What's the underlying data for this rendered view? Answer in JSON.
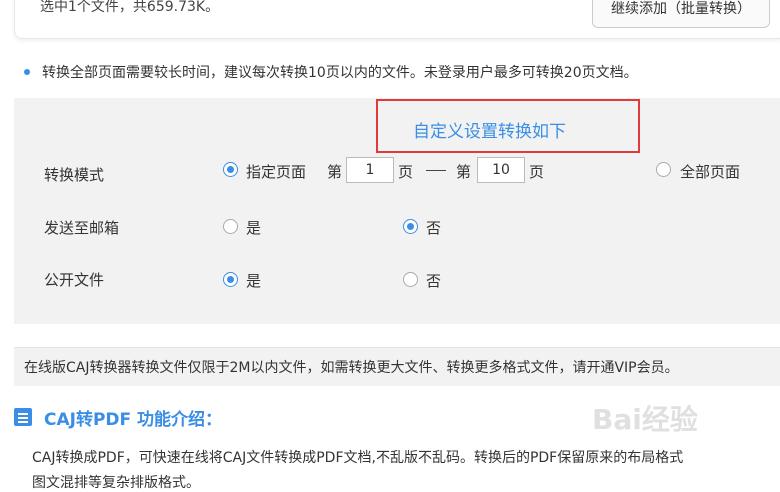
{
  "top": {
    "selection_summary": "选中1个文件，共659.73K。",
    "add_button": "继续添加（批量转换）"
  },
  "notice": "转换全部页面需要较长时间，建议每次转换10页以内的文件。未登录用户最多可转换20页文档。",
  "settings": {
    "title": "自定义设置转换如下",
    "convert_mode": {
      "label": "转换模式",
      "option_specified": "指定页面",
      "page_prefix": "第",
      "page_suffix": "页",
      "from_page": "1",
      "to_page": "10",
      "option_all": "全部页面",
      "selected": "specified"
    },
    "send_email": {
      "label": "发送至邮箱",
      "yes": "是",
      "no": "否",
      "selected": "no"
    },
    "public_file": {
      "label": "公开文件",
      "yes": "是",
      "no": "否",
      "selected": "yes"
    }
  },
  "info": "在线版CAJ转换器转换文件仅限于2M以内文件，如需转换更大文件、转换更多格式文件，请开通VIP会员。",
  "section": {
    "title": "CAJ转PDF 功能介绍：",
    "desc_line1": "CAJ转换成PDF，可快速在线将CAJ文件转换成PDF文档,不乱版不乱码。转换后的PDF保留原来的布局格式",
    "desc_line2": "图文混排等复杂排版格式。"
  },
  "watermark": "Bai经验",
  "colors": {
    "accent": "#3a8ee6",
    "highlight_border": "#e03b3b",
    "panel_bg": "#f2f2f2"
  }
}
